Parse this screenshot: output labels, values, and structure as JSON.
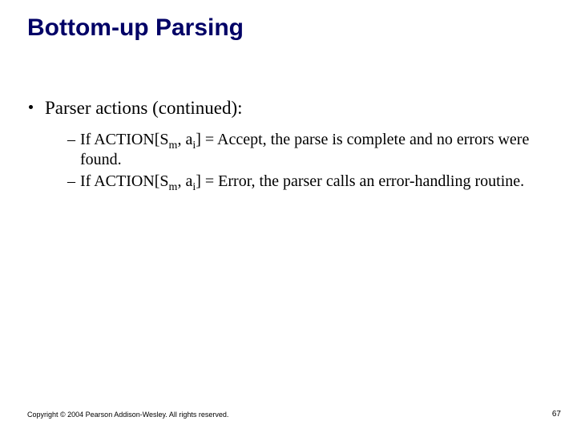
{
  "title": "Bottom-up Parsing",
  "bullet1": "Parser actions (continued):",
  "sub1": {
    "pre": "If ACTION[S",
    "subm": "m",
    "mid": ", a",
    "subi": "i",
    "post": "] = Accept, the parse is complete and no errors were found."
  },
  "sub2": {
    "pre": "If ACTION[S",
    "subm": "m",
    "mid": ", a",
    "subi": "i",
    "post": "] = Error, the parser calls an error-handling routine."
  },
  "copyright": "Copyright © 2004 Pearson Addison-Wesley. All rights reserved.",
  "page": "67"
}
